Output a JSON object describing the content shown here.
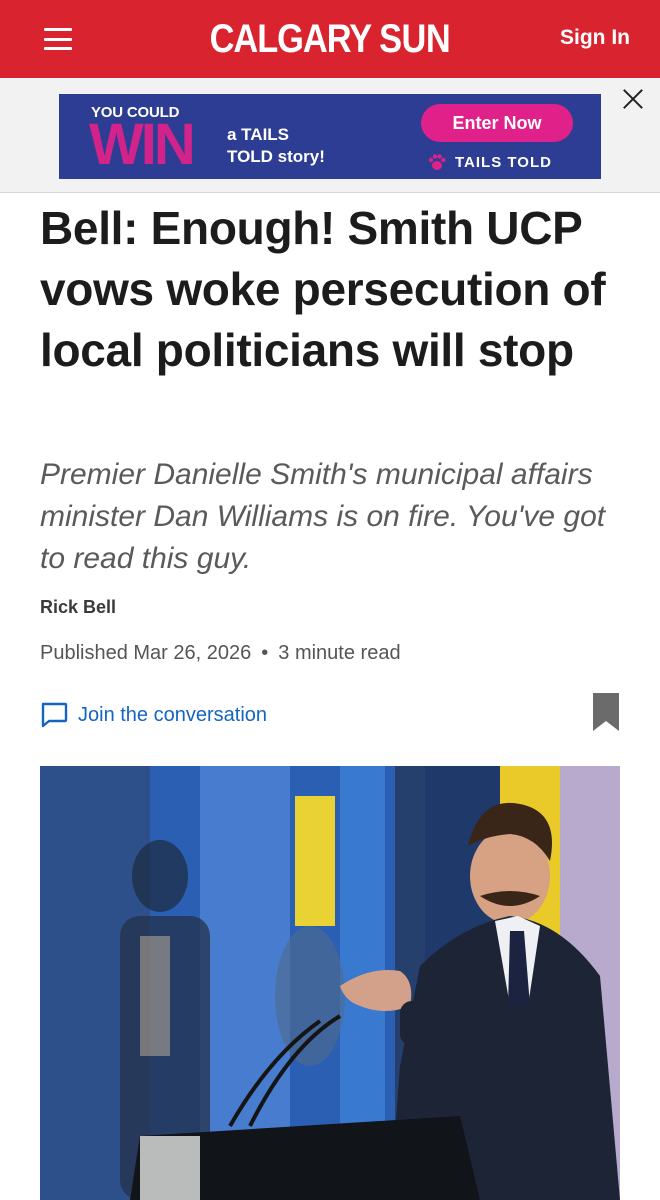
{
  "header": {
    "logo_primary": "CALGARY",
    "logo_secondary": "SUN",
    "signin_label": "Sign In",
    "background_color": "#d9232e"
  },
  "ad": {
    "line1": "YOU COULD",
    "win": "WIN",
    "tails_line": "a TAILS",
    "story_line": "TOLD story!",
    "cta": "Enter Now",
    "brand": "TAILS TOLD",
    "background_color": "#2c3d93",
    "accent_color": "#e0218a"
  },
  "article": {
    "headline": "Bell: Enough! Smith UCP vows woke persecution of local politicians will stop",
    "dek": "Premier Danielle Smith's municipal affairs minister Dan Williams is on fire. You've got to read this guy.",
    "author": "Rick Bell",
    "published": "Published Mar 26, 2026",
    "separator": "•",
    "read_time": "3 minute read",
    "conversation_label": "Join the conversation",
    "link_color": "#1565c0"
  },
  "icons": {
    "menu": "hamburger-menu-icon",
    "close": "close-icon",
    "chat": "chat-bubble-icon",
    "bookmark": "bookmark-icon",
    "paw": "paw-icon"
  }
}
